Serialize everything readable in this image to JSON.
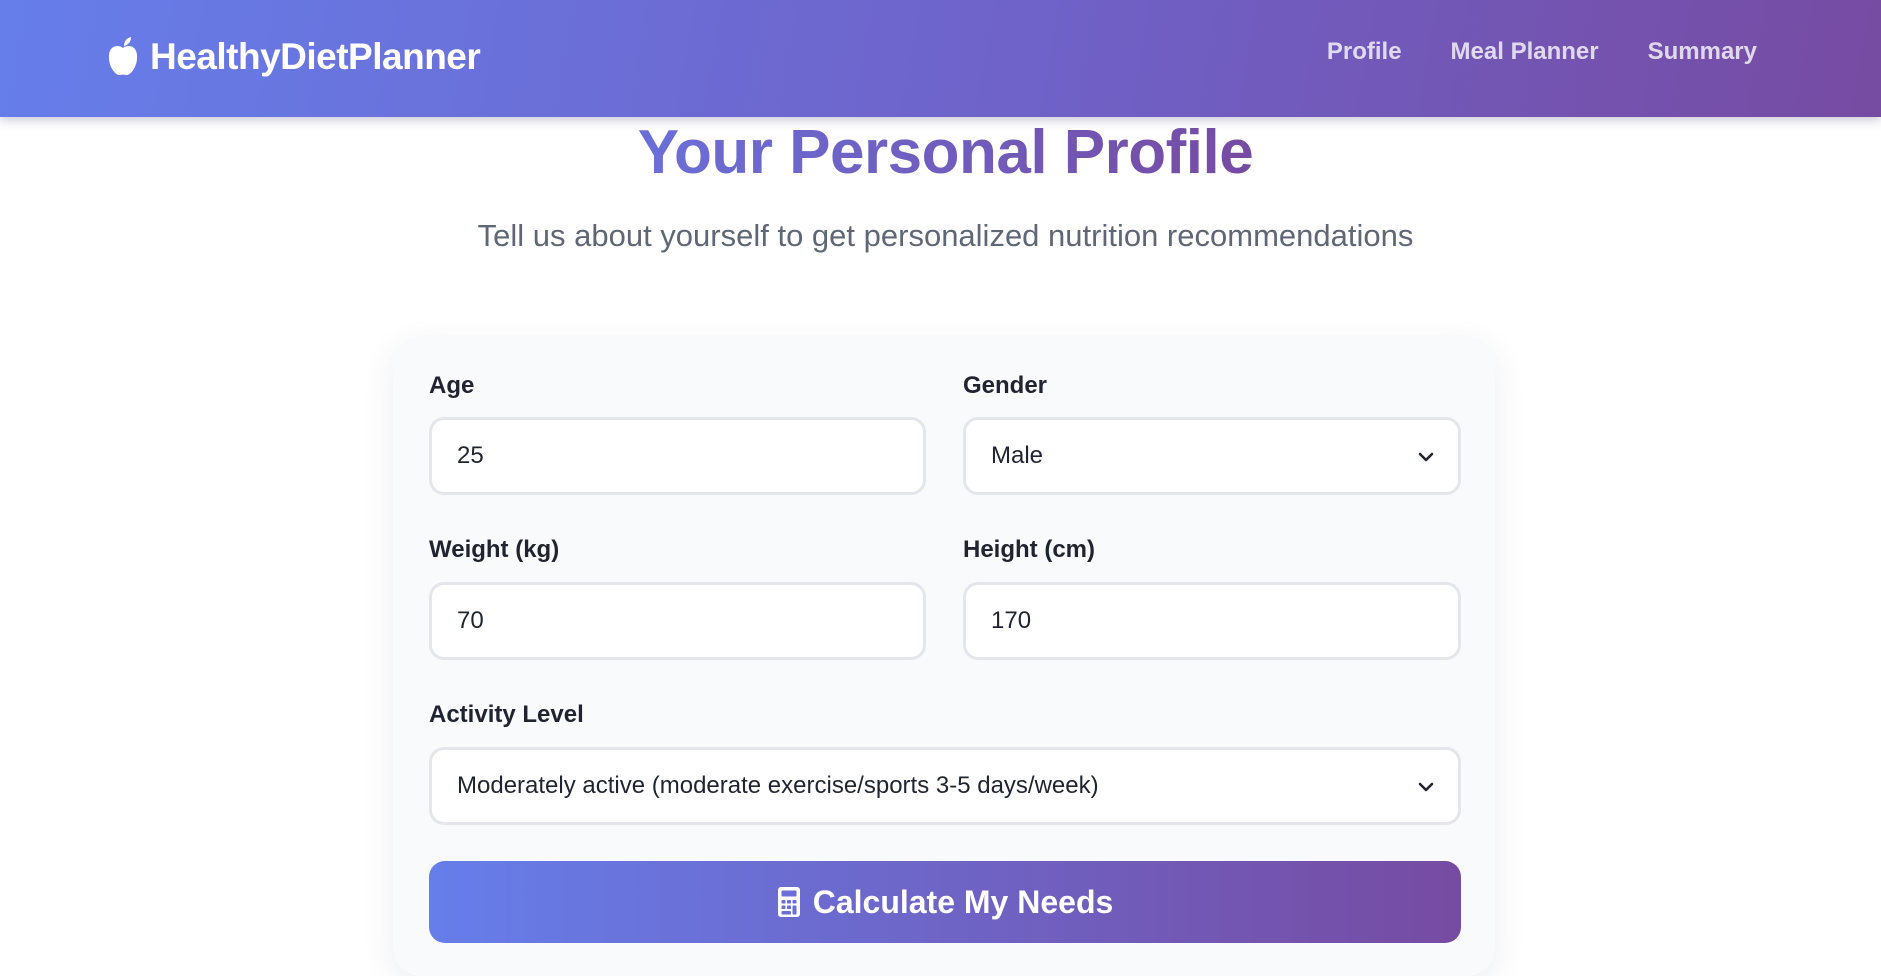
{
  "navbar": {
    "brand_name": "HealthyDietPlanner",
    "brand_icon": "apple-icon",
    "links": [
      {
        "label": "Profile"
      },
      {
        "label": "Meal Planner"
      },
      {
        "label": "Summary"
      }
    ]
  },
  "hero": {
    "title": "Your Personal Profile",
    "subtitle": "Tell us about yourself to get personalized nutrition recommendations"
  },
  "form": {
    "age": {
      "label": "Age",
      "value": "25"
    },
    "gender": {
      "label": "Gender",
      "value": "Male"
    },
    "weight": {
      "label": "Weight (kg)",
      "value": "70"
    },
    "height": {
      "label": "Height (cm)",
      "value": "170"
    },
    "activity": {
      "label": "Activity Level",
      "value": "Moderately active (moderate exercise/sports 3-5 days/week)"
    },
    "submit": {
      "label": "Calculate My Needs",
      "icon": "calculator-icon"
    }
  },
  "colors": {
    "gradient_start": "#667eea",
    "gradient_end": "#764ba2",
    "card_bg": "#f9fafc",
    "muted_text": "#5f6776"
  }
}
